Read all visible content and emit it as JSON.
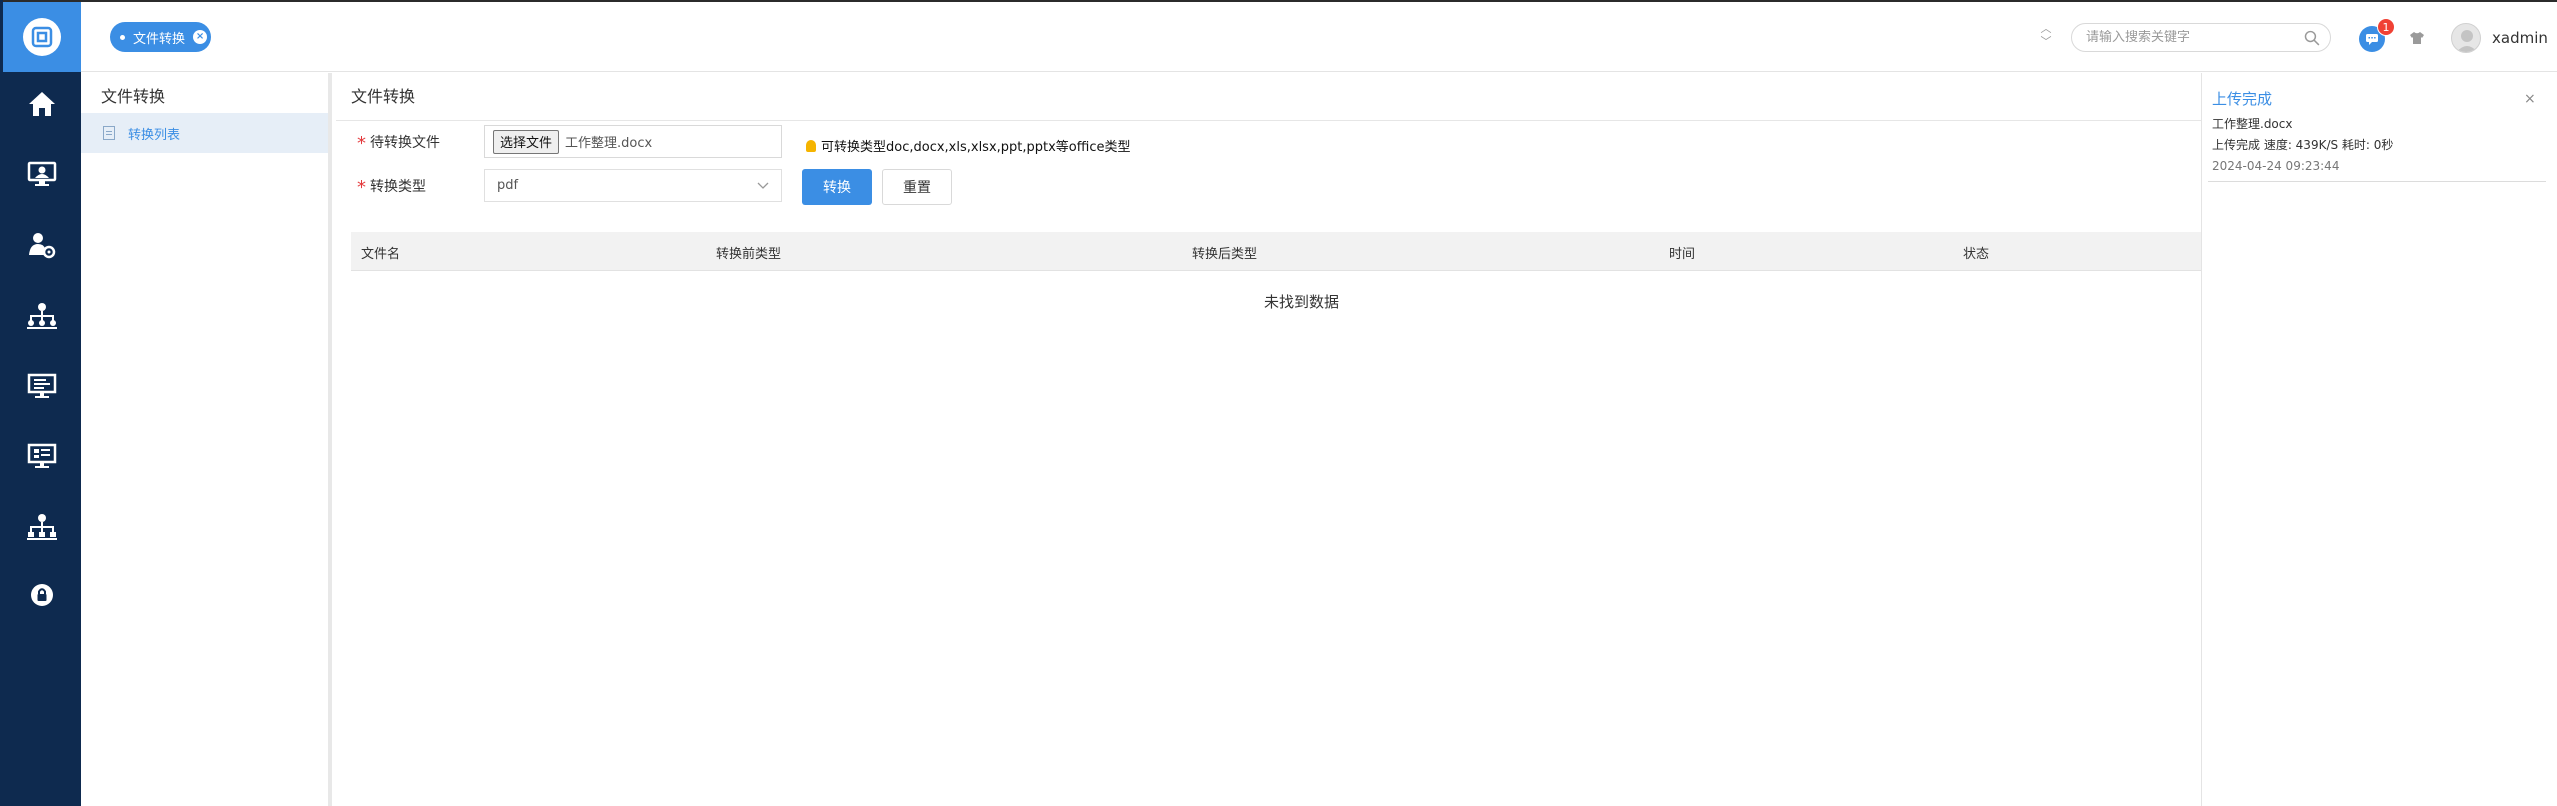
{
  "header": {
    "open_tab": "文件转换",
    "search_placeholder": "请输入搜索关键字",
    "message_badge": "1",
    "username": "xadmin"
  },
  "subnav": {
    "title": "文件转换",
    "items": [
      {
        "label": "转换列表"
      }
    ]
  },
  "main": {
    "title": "文件转换",
    "form": {
      "file_label": "待转换文件",
      "file_button": "选择文件",
      "file_name": "工作整理.docx",
      "hint": "可转换类型doc,docx,xls,xlsx,ppt,pptx等office类型",
      "type_label": "转换类型",
      "type_value": "pdf",
      "convert_button": "转换",
      "reset_button": "重置"
    },
    "table": {
      "columns": [
        "文件名",
        "转换前类型",
        "转换后类型",
        "时间",
        "状态"
      ],
      "empty_text": "未找到数据"
    }
  },
  "notification": {
    "title": "上传完成",
    "file": "工作整理.docx",
    "detail": "上传完成 速度: 439K/S 耗时: 0秒",
    "time": "2024-04-24 09:23:44",
    "close": "×"
  },
  "colors": {
    "primary": "#3b8ee4",
    "rail_bg": "#0e2a4f",
    "required": "#e4393c",
    "badge": "#f04134"
  },
  "icons": {
    "rail": [
      "home-icon",
      "monitor-user-icon",
      "user-settings-icon",
      "org-tree-icon",
      "screen-display-icon",
      "dashboard-screen-icon",
      "hierarchy-icon",
      "lock-circle-icon"
    ]
  }
}
